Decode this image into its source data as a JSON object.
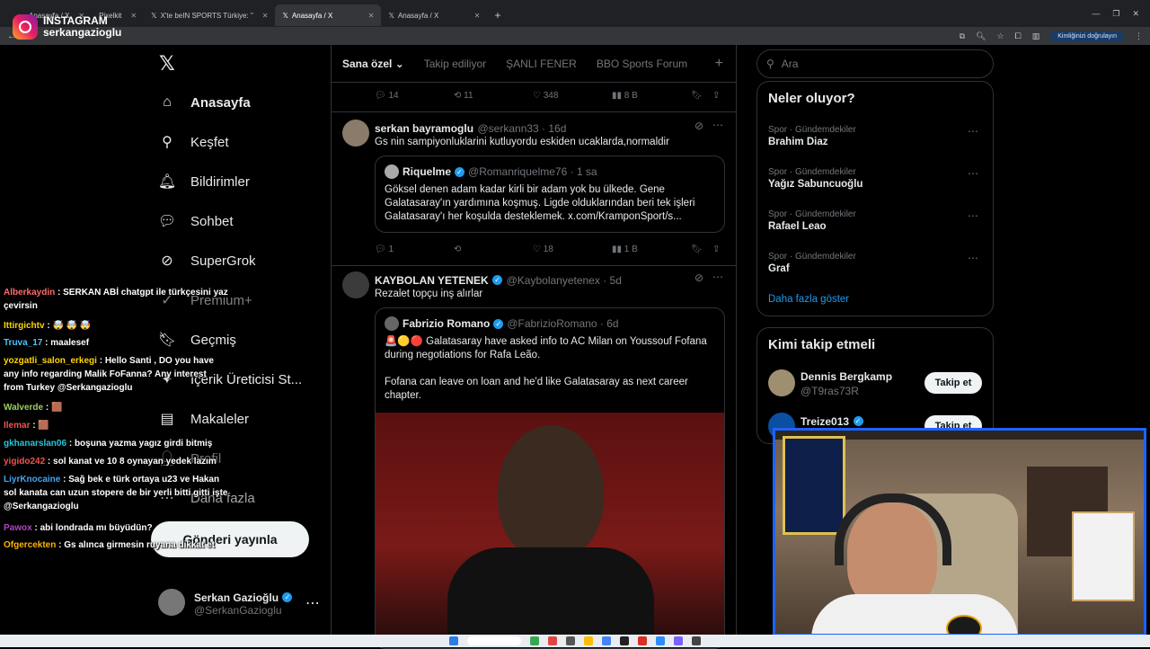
{
  "overlay": {
    "platform_label": "INSTAGRAM",
    "username": "serkangazioglu"
  },
  "browser": {
    "tabs": [
      {
        "title": "Anasayfa / X",
        "active": false
      },
      {
        "title": "Pixelkit",
        "active": false
      },
      {
        "title": "X'te beIN SPORTS Türkiye: \"",
        "active": false
      },
      {
        "title": "Anasayfa / X",
        "active": true
      },
      {
        "title": "Anasayfa / X",
        "active": false
      }
    ],
    "identity_button": "Kimliğinizi doğrulayın"
  },
  "nav": {
    "items": [
      {
        "label": "Anasayfa",
        "icon": "home-icon",
        "bold": true
      },
      {
        "label": "Keşfet",
        "icon": "search-icon"
      },
      {
        "label": "Bildirimler",
        "icon": "bell-icon"
      },
      {
        "label": "Sohbet",
        "icon": "chat-icon"
      },
      {
        "label": "SuperGrok",
        "icon": "grok-icon"
      },
      {
        "label": "Premium+",
        "icon": "premium-icon"
      },
      {
        "label": "Geçmiş",
        "icon": "bookmark-icon"
      },
      {
        "label": "İçerik Üreticisi St...",
        "icon": "creator-icon"
      },
      {
        "label": "Makaleler",
        "icon": "article-icon"
      },
      {
        "label": "Profil",
        "icon": "profile-icon"
      },
      {
        "label": "Daha fazla",
        "icon": "more-icon"
      }
    ],
    "post_button": "Gönderi yayınla",
    "account": {
      "name": "Serkan Gazioğlu",
      "handle": "@SerkanGazioglu"
    }
  },
  "feed": {
    "tabs": [
      "Sana özel",
      "Takip ediliyor",
      "ŞANLI FENER",
      "BBO Sports Forum"
    ],
    "top_actions": {
      "replies": "14",
      "retweets": "11",
      "likes": "348",
      "views": "8 B"
    },
    "tweets": [
      {
        "name": "serkan bayramoglu",
        "handle": "@serkann33 · 16d",
        "text": "Gs nin sampiyonluklarini kutluyordu eskiden ucaklarda,normaldir",
        "quote": {
          "name": "Riquelme",
          "handle": "@Romanriquelme76 · 1 sa",
          "text": "Göksel denen adam kadar kirli bir adam yok bu ülkede. Gene Galatasaray'ın yardımına koşmuş. Ligde olduklarından beri tek işleri Galatasaray'ı her koşulda desteklemek. x.com/KramponSport/s..."
        },
        "actions": {
          "replies": "1",
          "retweets": "",
          "likes": "18",
          "views": "1 B"
        }
      },
      {
        "name": "KAYBOLAN YETENEK",
        "handle": "@Kaybolanyetenex · 5d",
        "text": "Rezalet topçu inş alırlar",
        "quote": {
          "name": "Fabrizio Romano",
          "handle": "@FabrizioRomano · 6d",
          "text1": "Galatasaray have asked info to AC Milan on Youssouf Fofana during negotiations for Rafa Leão.",
          "text2": "Fofana can leave on loan and he'd like Galatasaray as next career chapter."
        }
      }
    ]
  },
  "right": {
    "search_placeholder": "Ara",
    "trends_title": "Neler oluyor?",
    "trends": [
      {
        "category": "Spor · Gündemdekiler",
        "name": "Brahim Diaz"
      },
      {
        "category": "Spor · Gündemdekiler",
        "name": "Yağız Sabuncuoğlu"
      },
      {
        "category": "Spor · Gündemdekiler",
        "name": "Rafael Leao"
      },
      {
        "category": "Spor · Gündemdekiler",
        "name": "Graf"
      }
    ],
    "show_more": "Daha fazla göster",
    "who_to_follow_title": "Kimi takip etmeli",
    "follow": [
      {
        "name": "Dennis Bergkamp",
        "handle": "@T9ras73R",
        "button": "Takip et"
      },
      {
        "name": "Treize013",
        "handle": "",
        "button": "Takip et"
      }
    ]
  },
  "chat": [
    {
      "user": "Alberkaydin",
      "color": "#ff6b6b",
      "text": "SERKAN ABİ chatgpt ile türkçesini yaz çevirsin"
    },
    {
      "user": "Ittirgichtv",
      "color": "#ffd400",
      "text": "🤯 🤯 🤯"
    },
    {
      "user": "Truva_17",
      "color": "#4fc3f7",
      "text": "maalesef"
    },
    {
      "user": "yozgatli_salon_erkegi",
      "color": "#ffd400",
      "text": "Hello Santi , DO you have any info regarding Malik FoFanna? Any interest from Turkey @Serkangazioglu"
    },
    {
      "user": "Walverde",
      "color": "#9ccc65",
      "text": "🟫"
    },
    {
      "user": "Ilemar",
      "color": "#ef5350",
      "text": "🟫"
    },
    {
      "user": "gkhanarslan06",
      "color": "#26c6da",
      "text": "boşuna yazma yagız girdi bitmiş"
    },
    {
      "user": "yigido242",
      "color": "#ef5350",
      "text": "sol kanat ve 10 8 oynayan yedek lazım"
    },
    {
      "user": "LiyrKnocaine",
      "color": "#42a5f5",
      "text": "Sağ bek e türk ortaya u23 ve Hakan sol kanata can uzun stopere de bir yerli bitti gitti işte @Serkangazioglu"
    },
    {
      "user": "Pawox",
      "color": "#ab47bc",
      "text": "abi londrada mı büyüdün?"
    },
    {
      "user": "Ofgercekten",
      "color": "#ffb300",
      "text": "Gs alınca girmesin ruyana dikkat et"
    }
  ],
  "colors": {
    "accent": "#1d9bf0",
    "border": "#2f3336",
    "muted": "#71767b",
    "webcam_border": "#1e63ff"
  }
}
